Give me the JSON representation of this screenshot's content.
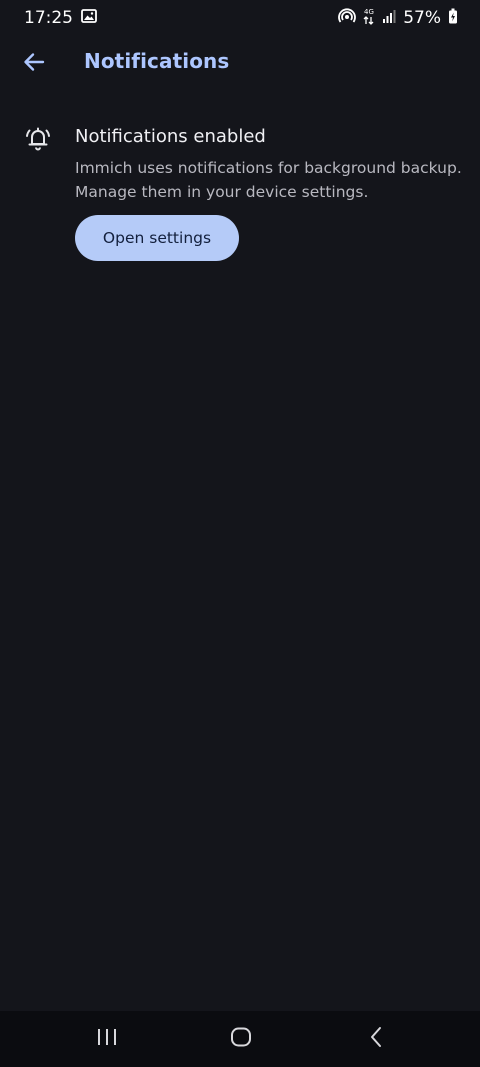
{
  "status_bar": {
    "time": "17:25",
    "battery": "57%"
  },
  "app_bar": {
    "title": "Notifications"
  },
  "notifications": {
    "title": "Notifications enabled",
    "description": "Immich uses notifications for background backup. Manage them in your device settings.",
    "button_label": "Open settings"
  },
  "icons": {
    "back": "arrow-left-icon",
    "bell": "bell-ringing-icon",
    "gallery": "image-icon",
    "hotspot": "hotspot-icon",
    "network": "4g-data-icon",
    "signal": "signal-icon",
    "battery": "battery-charging-icon",
    "recents": "recent-apps-icon",
    "home": "home-icon",
    "nav_back": "nav-back-icon"
  },
  "colors": {
    "background": "#14151b",
    "accent": "#adc6ff",
    "button": "#b5cbf8"
  }
}
